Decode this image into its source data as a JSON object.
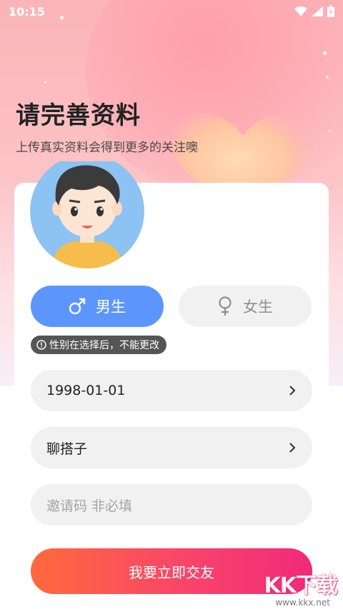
{
  "status_bar": {
    "time": "10:15",
    "icons": [
      "wifi-icon",
      "signal-icon",
      "battery-icon"
    ]
  },
  "header": {
    "title": "请完善资料",
    "subtitle": "上传真实资料会得到更多的关注噢"
  },
  "gender": {
    "male_label": "男生",
    "female_label": "女生",
    "selected": "male",
    "notice": "性别在选择后，不能更改"
  },
  "form": {
    "birthday_value": "1998-01-01",
    "purpose_value": "聊搭子",
    "invite_placeholder": "邀请码 非必填"
  },
  "submit_label": "我要立即交友",
  "watermark": {
    "logo": "KK下载",
    "url": "www.kkx.net"
  },
  "colors": {
    "male_accent": "#5c96fd",
    "submit_gradient_start": "#ff6a3d",
    "submit_gradient_end": "#f02a7a",
    "header_bg": "#fbb4b8"
  }
}
